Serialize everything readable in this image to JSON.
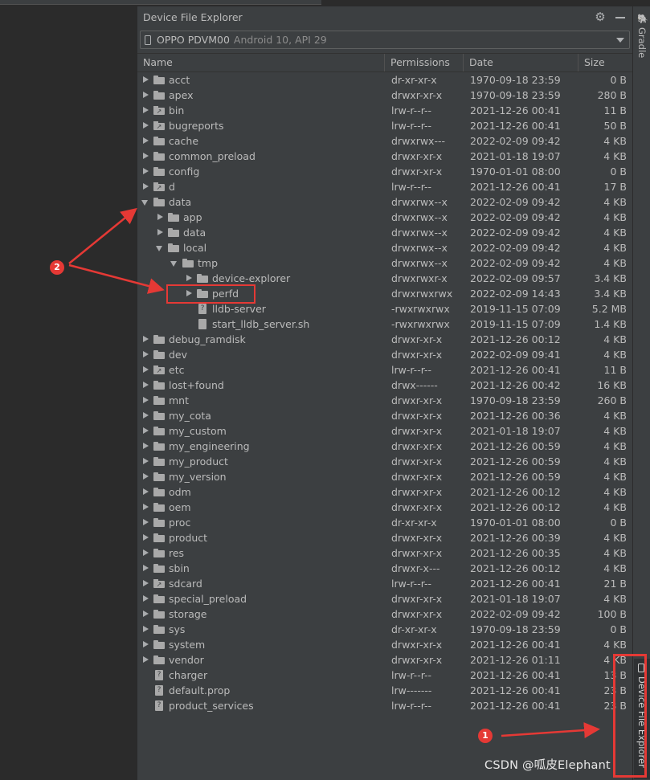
{
  "window": {
    "title": "Device File Explorer"
  },
  "device": {
    "name": "OPPO PDVM00",
    "meta": "Android 10, API 29"
  },
  "columns": {
    "name": "Name",
    "permissions": "Permissions",
    "date": "Date",
    "size": "Size"
  },
  "rows": [
    {
      "name": "acct",
      "type": "folder",
      "expand": "collapsed",
      "depth": 0,
      "perm": "dr-xr-xr-x",
      "date": "1970-09-18 23:59",
      "size": "0 B"
    },
    {
      "name": "apex",
      "type": "folder",
      "expand": "collapsed",
      "depth": 0,
      "perm": "drwxr-xr-x",
      "date": "1970-09-18 23:59",
      "size": "280 B"
    },
    {
      "name": "bin",
      "type": "link-folder",
      "expand": "collapsed",
      "depth": 0,
      "perm": "lrw-r--r--",
      "date": "2021-12-26 00:41",
      "size": "11 B"
    },
    {
      "name": "bugreports",
      "type": "link-folder",
      "expand": "collapsed",
      "depth": 0,
      "perm": "lrw-r--r--",
      "date": "2021-12-26 00:41",
      "size": "50 B"
    },
    {
      "name": "cache",
      "type": "folder",
      "expand": "collapsed",
      "depth": 0,
      "perm": "drwxrwx---",
      "date": "2022-02-09 09:42",
      "size": "4 KB"
    },
    {
      "name": "common_preload",
      "type": "folder",
      "expand": "collapsed",
      "depth": 0,
      "perm": "drwxr-xr-x",
      "date": "2021-01-18 19:07",
      "size": "4 KB"
    },
    {
      "name": "config",
      "type": "folder",
      "expand": "collapsed",
      "depth": 0,
      "perm": "drwxr-xr-x",
      "date": "1970-01-01 08:00",
      "size": "0 B"
    },
    {
      "name": "d",
      "type": "link-folder",
      "expand": "collapsed",
      "depth": 0,
      "perm": "lrw-r--r--",
      "date": "2021-12-26 00:41",
      "size": "17 B"
    },
    {
      "name": "data",
      "type": "folder",
      "expand": "expanded",
      "depth": 0,
      "perm": "drwxrwx--x",
      "date": "2022-02-09 09:42",
      "size": "4 KB"
    },
    {
      "name": "app",
      "type": "folder",
      "expand": "collapsed",
      "depth": 1,
      "perm": "drwxrwx--x",
      "date": "2022-02-09 09:42",
      "size": "4 KB"
    },
    {
      "name": "data",
      "type": "folder",
      "expand": "collapsed",
      "depth": 1,
      "perm": "drwxrwx--x",
      "date": "2022-02-09 09:42",
      "size": "4 KB"
    },
    {
      "name": "local",
      "type": "folder",
      "expand": "expanded",
      "depth": 1,
      "perm": "drwxrwx--x",
      "date": "2022-02-09 09:42",
      "size": "4 KB"
    },
    {
      "name": "tmp",
      "type": "folder",
      "expand": "expanded",
      "depth": 2,
      "perm": "drwxrwx--x",
      "date": "2022-02-09 09:42",
      "size": "4 KB"
    },
    {
      "name": "device-explorer",
      "type": "folder",
      "expand": "collapsed",
      "depth": 3,
      "perm": "drwxrwxr-x",
      "date": "2022-02-09 09:57",
      "size": "3.4 KB"
    },
    {
      "name": "perfd",
      "type": "folder",
      "expand": "collapsed",
      "depth": 3,
      "perm": "drwxrwxrwx",
      "date": "2022-02-09 14:43",
      "size": "3.4 KB"
    },
    {
      "name": "lldb-server",
      "type": "link-file",
      "expand": "none",
      "depth": 3,
      "perm": "-rwxrwxrwx",
      "date": "2019-11-15 07:09",
      "size": "5.2 MB"
    },
    {
      "name": "start_lldb_server.sh",
      "type": "file",
      "expand": "none",
      "depth": 3,
      "perm": "-rwxrwxrwx",
      "date": "2019-11-15 07:09",
      "size": "1.4 KB"
    },
    {
      "name": "debug_ramdisk",
      "type": "folder",
      "expand": "collapsed",
      "depth": 0,
      "perm": "drwxr-xr-x",
      "date": "2021-12-26 00:12",
      "size": "4 KB"
    },
    {
      "name": "dev",
      "type": "folder",
      "expand": "collapsed",
      "depth": 0,
      "perm": "drwxr-xr-x",
      "date": "2022-02-09 09:41",
      "size": "4 KB"
    },
    {
      "name": "etc",
      "type": "link-folder",
      "expand": "collapsed",
      "depth": 0,
      "perm": "lrw-r--r--",
      "date": "2021-12-26 00:41",
      "size": "11 B"
    },
    {
      "name": "lost+found",
      "type": "folder",
      "expand": "collapsed",
      "depth": 0,
      "perm": "drwx------",
      "date": "2021-12-26 00:42",
      "size": "16 KB"
    },
    {
      "name": "mnt",
      "type": "folder",
      "expand": "collapsed",
      "depth": 0,
      "perm": "drwxr-xr-x",
      "date": "1970-09-18 23:59",
      "size": "260 B"
    },
    {
      "name": "my_cota",
      "type": "folder",
      "expand": "collapsed",
      "depth": 0,
      "perm": "drwxr-xr-x",
      "date": "2021-12-26 00:36",
      "size": "4 KB"
    },
    {
      "name": "my_custom",
      "type": "folder",
      "expand": "collapsed",
      "depth": 0,
      "perm": "drwxr-xr-x",
      "date": "2021-01-18 19:07",
      "size": "4 KB"
    },
    {
      "name": "my_engineering",
      "type": "folder",
      "expand": "collapsed",
      "depth": 0,
      "perm": "drwxr-xr-x",
      "date": "2021-12-26 00:59",
      "size": "4 KB"
    },
    {
      "name": "my_product",
      "type": "folder",
      "expand": "collapsed",
      "depth": 0,
      "perm": "drwxr-xr-x",
      "date": "2021-12-26 00:59",
      "size": "4 KB"
    },
    {
      "name": "my_version",
      "type": "folder",
      "expand": "collapsed",
      "depth": 0,
      "perm": "drwxr-xr-x",
      "date": "2021-12-26 00:59",
      "size": "4 KB"
    },
    {
      "name": "odm",
      "type": "folder",
      "expand": "collapsed",
      "depth": 0,
      "perm": "drwxr-xr-x",
      "date": "2021-12-26 00:12",
      "size": "4 KB"
    },
    {
      "name": "oem",
      "type": "folder",
      "expand": "collapsed",
      "depth": 0,
      "perm": "drwxr-xr-x",
      "date": "2021-12-26 00:12",
      "size": "4 KB"
    },
    {
      "name": "proc",
      "type": "folder",
      "expand": "collapsed",
      "depth": 0,
      "perm": "dr-xr-xr-x",
      "date": "1970-01-01 08:00",
      "size": "0 B"
    },
    {
      "name": "product",
      "type": "folder",
      "expand": "collapsed",
      "depth": 0,
      "perm": "drwxr-xr-x",
      "date": "2021-12-26 00:39",
      "size": "4 KB"
    },
    {
      "name": "res",
      "type": "folder",
      "expand": "collapsed",
      "depth": 0,
      "perm": "drwxr-xr-x",
      "date": "2021-12-26 00:35",
      "size": "4 KB"
    },
    {
      "name": "sbin",
      "type": "folder",
      "expand": "collapsed",
      "depth": 0,
      "perm": "drwxr-x---",
      "date": "2021-12-26 00:12",
      "size": "4 KB"
    },
    {
      "name": "sdcard",
      "type": "link-folder",
      "expand": "collapsed",
      "depth": 0,
      "perm": "lrw-r--r--",
      "date": "2021-12-26 00:41",
      "size": "21 B"
    },
    {
      "name": "special_preload",
      "type": "folder",
      "expand": "collapsed",
      "depth": 0,
      "perm": "drwxr-xr-x",
      "date": "2021-01-18 19:07",
      "size": "4 KB"
    },
    {
      "name": "storage",
      "type": "folder",
      "expand": "collapsed",
      "depth": 0,
      "perm": "drwxr-xr-x",
      "date": "2022-02-09 09:42",
      "size": "100 B"
    },
    {
      "name": "sys",
      "type": "folder",
      "expand": "collapsed",
      "depth": 0,
      "perm": "dr-xr-xr-x",
      "date": "1970-09-18 23:59",
      "size": "0 B"
    },
    {
      "name": "system",
      "type": "folder",
      "expand": "collapsed",
      "depth": 0,
      "perm": "drwxr-xr-x",
      "date": "2021-12-26 00:41",
      "size": "4 KB"
    },
    {
      "name": "vendor",
      "type": "folder",
      "expand": "collapsed",
      "depth": 0,
      "perm": "drwxr-xr-x",
      "date": "2021-12-26 01:11",
      "size": "4 KB"
    },
    {
      "name": "charger",
      "type": "link-file",
      "expand": "none",
      "depth": 0,
      "perm": "lrw-r--r--",
      "date": "2021-12-26 00:41",
      "size": "13 B"
    },
    {
      "name": "default.prop",
      "type": "link-file",
      "expand": "none",
      "depth": 0,
      "perm": "lrw-------",
      "date": "2021-12-26 00:41",
      "size": "23 B"
    },
    {
      "name": "product_services",
      "type": "link-file",
      "expand": "none",
      "depth": 0,
      "perm": "lrw-r--r--",
      "date": "2021-12-26 00:41",
      "size": "23 B"
    }
  ],
  "side_tabs": {
    "gradle": "Gradle",
    "device_file_explorer": "Device File Explorer"
  },
  "annotations": {
    "badge_1": "1",
    "badge_2": "2",
    "color": "#e53935"
  },
  "watermark": "CSDN @呱皮Elephant"
}
